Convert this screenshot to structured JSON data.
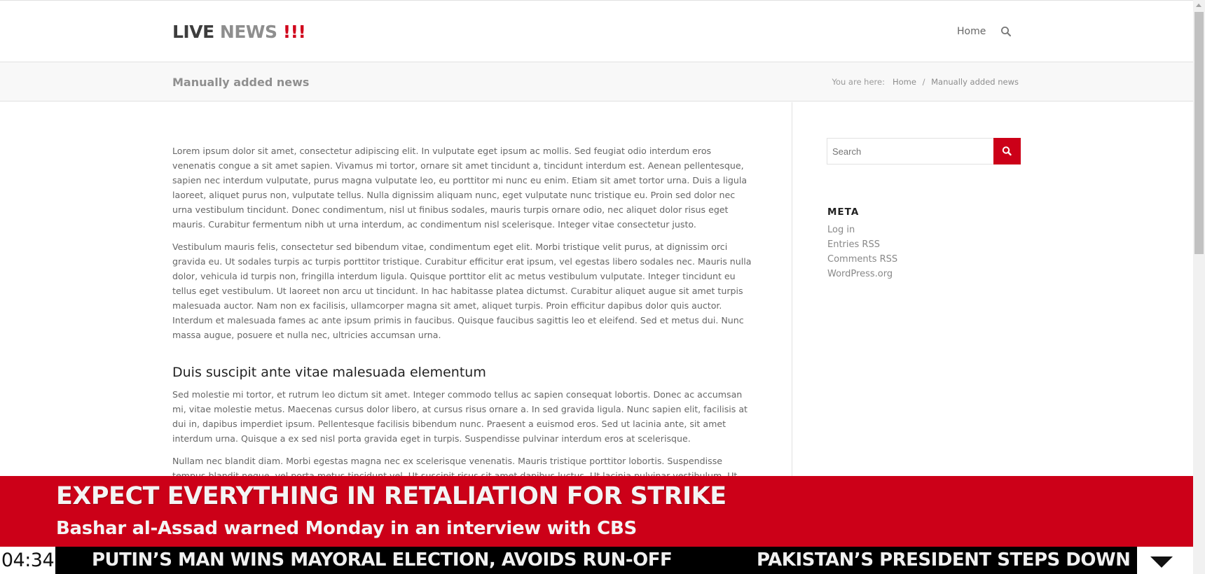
{
  "header": {
    "logo": {
      "part1": "LIVE",
      "part2": "NEWS",
      "part3": "!!!"
    },
    "nav": {
      "home": "Home"
    },
    "search_icon": "search-icon"
  },
  "titlebar": {
    "title": "Manually added news",
    "breadcrumb": {
      "prefix": "You are here:",
      "home": "Home",
      "separator": "/",
      "current": "Manually added news"
    }
  },
  "article": {
    "p1": "Lorem ipsum dolor sit amet, consectetur adipiscing elit. In vulputate eget ipsum ac mollis. Sed feugiat odio interdum eros venenatis congue a sit amet sapien. Vivamus mi tortor, ornare sit amet tincidunt a, tincidunt interdum est. Aenean pellentesque, sapien nec interdum vulputate, purus magna vulputate leo, eu porttitor mi nunc eu enim. Etiam sit amet tortor urna. Duis a ligula laoreet, aliquet purus non, vulputate tellus. Nulla dignissim aliquam nunc, eget vulputate nunc tristique eu. Proin sed dolor nec urna vestibulum tincidunt. Donec condimentum, nisl ut finibus sodales, mauris turpis ornare odio, nec aliquet dolor risus eget mauris. Curabitur fermentum nibh ut urna interdum, ac condimentum nisl scelerisque. Integer vitae consectetur justo.",
    "p2": "Vestibulum mauris felis, consectetur sed bibendum vitae, condimentum eget elit. Morbi tristique velit purus, at dignissim orci gravida eu. Ut sodales turpis ac turpis porttitor tristique. Curabitur efficitur erat ipsum, vel egestas libero sodales nec. Mauris nulla dolor, vehicula id turpis non, fringilla interdum ligula. Quisque porttitor elit ac metus vestibulum vulputate. Integer tincidunt eu tellus eget vestibulum. Ut laoreet non arcu ut tincidunt. In hac habitasse platea dictumst. Curabitur aliquet augue sit amet turpis malesuada auctor. Nam non ex facilisis, ullamcorper magna sit amet, aliquet turpis. Proin efficitur dapibus dolor quis auctor. Interdum et malesuada fames ac ante ipsum primis in faucibus. Quisque faucibus sagittis leo et eleifend. Sed et metus dui. Nunc massa augue, posuere et nulla nec, ultricies accumsan urna.",
    "heading": "Duis suscipit ante vitae malesuada elementum",
    "p3": "Sed molestie mi tortor, et rutrum leo dictum sit amet. Integer commodo tellus ac sapien consequat lobortis. Donec ac accumsan mi, vitae molestie metus. Maecenas cursus dolor libero, at cursus risus ornare a. In sed gravida ligula. Nunc sapien elit, facilisis at dui in, dapibus imperdiet ipsum. Pellentesque facilisis bibendum nunc. Praesent a euismod eros. Sed ut lacinia ante, sit amet interdum urna. Quisque a ex sed nisl porta gravida eget in turpis. Suspendisse pulvinar interdum eros at scelerisque.",
    "p4": "Nullam nec blandit diam. Morbi egestas magna nec ex scelerisque venenatis. Mauris tristique porttitor lobortis. Suspendisse tempus blandit neque, vel porta metus tincidunt vel. Ut suscipit risus sit amet dapibus luctus. Ut lacinia pulvinar vestibulum. Ut suscipit diam a"
  },
  "sidebar": {
    "search": {
      "placeholder": "Search"
    },
    "meta": {
      "title": "META",
      "links": [
        "Log in",
        "Entries RSS",
        "Comments RSS",
        "WordPress.org"
      ]
    }
  },
  "breaking": {
    "headline": "EXPECT EVERYTHING IN RETALIATION FOR STRIKE",
    "subhead": "Bashar al-Assad warned Monday in an interview with CBS",
    "clock": "04:34",
    "ticker": [
      "PUTIN’S MAN WINS MAYORAL ELECTION, AVOIDS RUN-OFF",
      "PAKISTAN’S PRESIDENT STEPS DOWN"
    ],
    "toggle_icon": "chevron-down-icon"
  },
  "colors": {
    "accent": "#cc0018",
    "logo_dark": "#3d3d3d",
    "logo_gray": "#8e8e8e",
    "ticker_bg": "#000000"
  }
}
